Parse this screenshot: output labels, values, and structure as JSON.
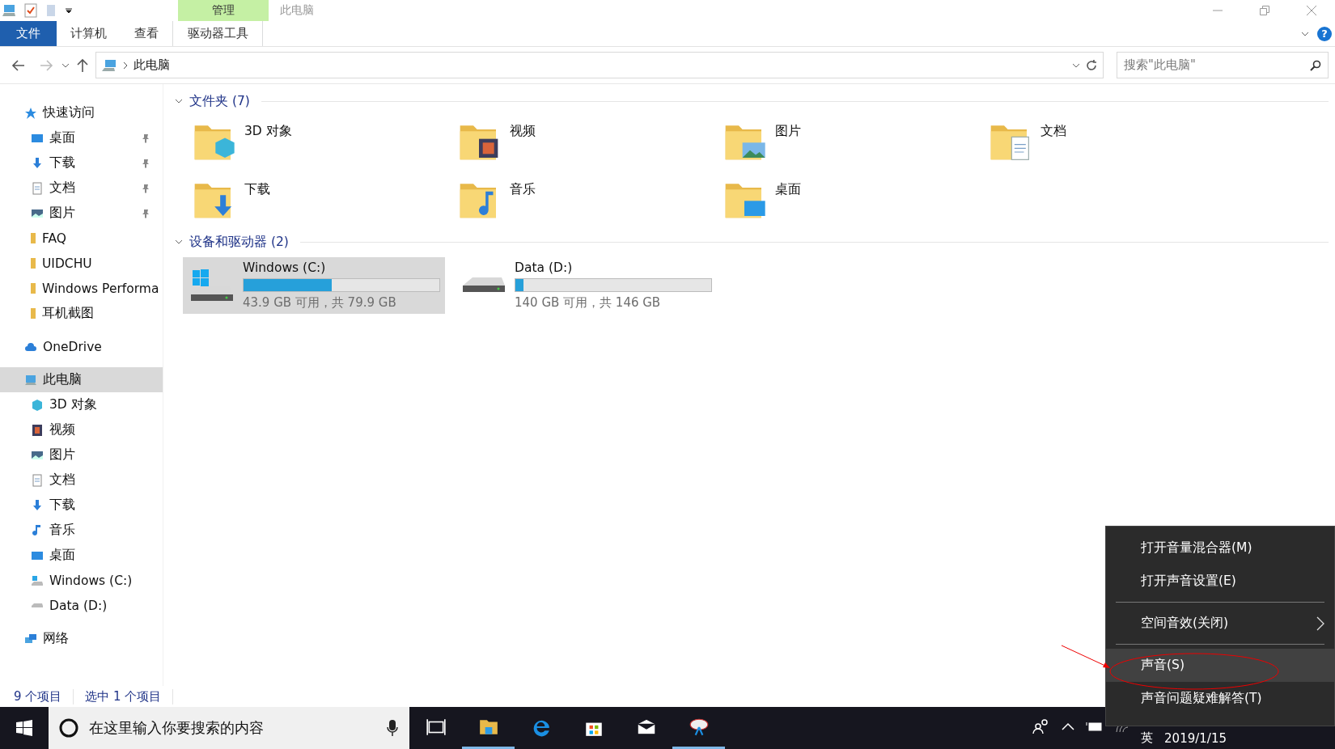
{
  "title_bar": {
    "context_tab": "管理",
    "title": "此电脑",
    "help": "?"
  },
  "ribbon_tabs": [
    {
      "label": "文件",
      "kind": "file"
    },
    {
      "label": "计算机",
      "kind": "normal"
    },
    {
      "label": "查看",
      "kind": "normal"
    },
    {
      "label": "驱动器工具",
      "kind": "context"
    }
  ],
  "address": {
    "path": "此电脑"
  },
  "search": {
    "placeholder": "搜索\"此电脑\""
  },
  "sidebar": {
    "items": [
      {
        "label": "快速访问",
        "kind": "star",
        "selected": false,
        "children": [
          {
            "label": "桌面",
            "kind": "desktop",
            "pinned": true,
            "selected": false
          },
          {
            "label": "下载",
            "kind": "download",
            "pinned": true,
            "selected": false
          },
          {
            "label": "文档",
            "kind": "document",
            "pinned": true,
            "selected": false
          },
          {
            "label": "图片",
            "kind": "picture",
            "pinned": true,
            "selected": false
          },
          {
            "label": "FAQ",
            "kind": "folder",
            "pinned": false,
            "selected": false
          },
          {
            "label": "UIDCHU",
            "kind": "folder",
            "pinned": false,
            "selected": false
          },
          {
            "label": "Windows Performa",
            "kind": "folder",
            "pinned": false,
            "selected": false
          },
          {
            "label": "耳机截图",
            "kind": "folder",
            "pinned": false,
            "selected": false
          }
        ]
      },
      {
        "label": "OneDrive",
        "kind": "cloud",
        "selected": false
      },
      {
        "label": "此电脑",
        "kind": "pc",
        "selected": true,
        "children": [
          {
            "label": "3D 对象",
            "kind": "cube",
            "pinned": false,
            "selected": false
          },
          {
            "label": "视频",
            "kind": "video",
            "pinned": false,
            "selected": false
          },
          {
            "label": "图片",
            "kind": "picture",
            "pinned": false,
            "selected": false
          },
          {
            "label": "文档",
            "kind": "document",
            "pinned": false,
            "selected": false
          },
          {
            "label": "下载",
            "kind": "download",
            "pinned": false,
            "selected": false
          },
          {
            "label": "音乐",
            "kind": "music",
            "pinned": false,
            "selected": false
          },
          {
            "label": "桌面",
            "kind": "desktop",
            "pinned": false,
            "selected": false
          },
          {
            "label": "Windows (C:)",
            "kind": "windrive",
            "pinned": false,
            "selected": false
          },
          {
            "label": "Data (D:)",
            "kind": "drive",
            "pinned": false,
            "selected": false
          }
        ]
      },
      {
        "label": "网络",
        "kind": "network",
        "selected": false
      }
    ]
  },
  "folders_section": {
    "title": "文件夹 (7)",
    "expanded": true,
    "folders": [
      {
        "label": "3D 对象",
        "kind": "cube"
      },
      {
        "label": "视频",
        "kind": "video"
      },
      {
        "label": "图片",
        "kind": "picture"
      },
      {
        "label": "文档",
        "kind": "document"
      },
      {
        "label": "下载",
        "kind": "download"
      },
      {
        "label": "音乐",
        "kind": "music"
      },
      {
        "label": "桌面",
        "kind": "desktop"
      }
    ]
  },
  "drives_section": {
    "title": "设备和驱动器 (2)",
    "expanded": true,
    "drives": [
      {
        "label": "Windows (C:)",
        "kind": "windrive",
        "level": 0.45,
        "reading": "43.9 GB 可用，共 79.9 GB",
        "selected": true
      },
      {
        "label": "Data (D:)",
        "kind": "drive",
        "level": 0.04,
        "reading": "140 GB 可用，共 146 GB",
        "selected": false
      }
    ]
  },
  "status_bar": [
    "9 个项目",
    "选中 1 个项目"
  ],
  "taskbar": {
    "search_placeholder": "在这里输入你要搜索的内容",
    "apps": [
      {
        "kind": "taskview",
        "active": false
      },
      {
        "kind": "explorer",
        "active": true
      },
      {
        "kind": "edge",
        "active": false
      },
      {
        "kind": "store",
        "active": false
      },
      {
        "kind": "mail",
        "active": false
      },
      {
        "kind": "paint",
        "active": true
      }
    ],
    "ime": "英",
    "date": "2019/1/15"
  },
  "context_menu": {
    "groups": [
      [
        {
          "label": "打开音量混合器(M)",
          "submenu": false,
          "selected": false
        },
        {
          "label": "打开声音设置(E)",
          "submenu": false,
          "selected": false
        }
      ],
      [
        {
          "label": "空间音效(关闭)",
          "submenu": true,
          "selected": false
        }
      ],
      [
        {
          "label": "声音(S)",
          "submenu": false,
          "selected": true
        },
        {
          "label": "声音问题疑难解答(T)",
          "submenu": false,
          "selected": false
        }
      ]
    ]
  }
}
